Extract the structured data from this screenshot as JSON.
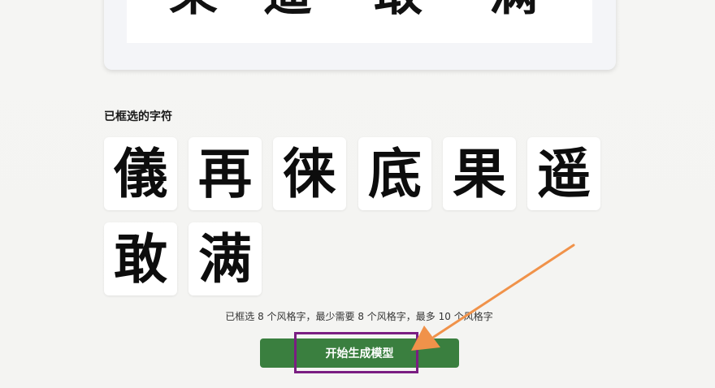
{
  "preview": {
    "glyphs": [
      "果",
      "遥",
      "敢",
      "满"
    ]
  },
  "selected": {
    "title": "已框选的字符",
    "chars": [
      "儀",
      "再",
      "徕",
      "底",
      "果",
      "遥",
      "敢",
      "满"
    ]
  },
  "info": {
    "text": "已框选 8 个风格字，最少需要 8 个风格字，最多 10 个风格字"
  },
  "actions": {
    "start_label": "开始生成模型"
  },
  "annotation": {
    "box_color": "#7a1e82",
    "arrow_color": "#f0924a"
  },
  "colors": {
    "button": "#3a7f3f"
  }
}
